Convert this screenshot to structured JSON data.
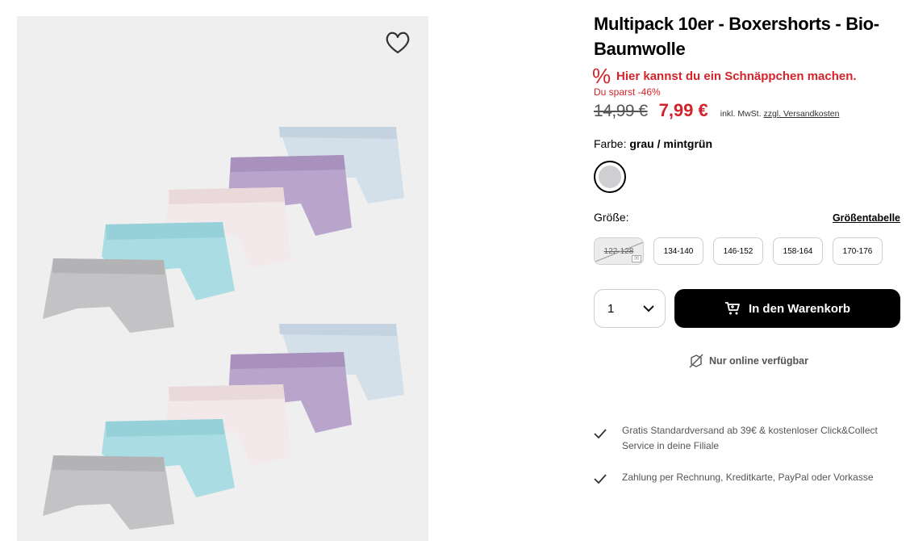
{
  "product": {
    "title": "Multipack 10er - Boxershorts - Bio-Baumwolle",
    "deal_icon": "%",
    "deal_text": "Hier kannst du ein Schnäppchen machen.",
    "savings": "Du sparst -46%",
    "old_price": "14,99 €",
    "new_price": "7,99 €",
    "tax_prefix": "inkl. MwSt.",
    "shipping_link": "zzgl. Versandkosten",
    "color_label": "Farbe:",
    "color_value": "grau / mintgrün",
    "size_label": "Größe:",
    "size_chart_link": "Größentabelle",
    "sizes": [
      "122-128",
      "134-140",
      "146-152",
      "158-164",
      "170-176"
    ],
    "quantity": "1",
    "cart_button": "In den Warenkorb",
    "online_only": "Nur online verfügbar",
    "usps": [
      "Gratis Standardversand ab 39€ & kostenloser Click&Collect Service in deine Filiale",
      "Zahlung per Rechnung, Kreditkarte, PayPal oder Vorkasse"
    ]
  },
  "colors": {
    "sale_red": "#d3232b",
    "swatch_grey": "#cfcfd2",
    "gallery_bg": "#efefef",
    "button_black": "#000000"
  },
  "icons": {
    "favorite": "heart-icon",
    "deal": "percent-icon",
    "cart": "cart-icon",
    "online": "no-store-icon",
    "check": "check-icon",
    "dropdown": "chevron-down-icon"
  }
}
